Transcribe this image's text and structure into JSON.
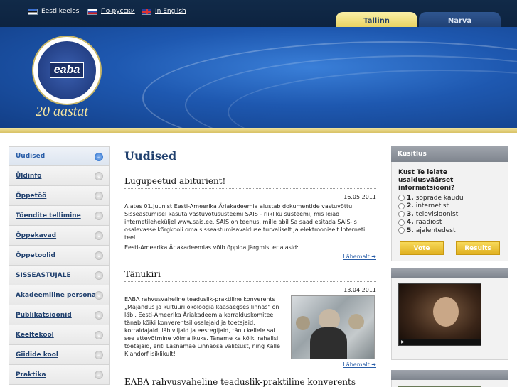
{
  "languages": [
    {
      "label": "Eesti keeles",
      "flag": "flag-ee-icon"
    },
    {
      "label": "По-русски",
      "flag": "flag-ru-icon"
    },
    {
      "label": "In English",
      "flag": "flag-gb-icon"
    }
  ],
  "city_tabs": [
    {
      "label": "Tallinn",
      "active": true
    },
    {
      "label": "Narva",
      "active": false
    }
  ],
  "banner": {
    "logo_text": "eaba",
    "anniversary": "20 aastat"
  },
  "nav": [
    {
      "label": "Uudised",
      "active": true
    },
    {
      "label": "Üldinfo"
    },
    {
      "label": "Õppetöö"
    },
    {
      "label": "Tõendite tellimine"
    },
    {
      "label": "Õppekavad"
    },
    {
      "label": "Õppetoolid"
    },
    {
      "label": "SISSEASTUJALE"
    },
    {
      "label": "Akadeemiline personal"
    },
    {
      "label": "Publikatsioonid"
    },
    {
      "label": "Keeltekool"
    },
    {
      "label": "Giidide kool"
    },
    {
      "label": "Praktika"
    }
  ],
  "main": {
    "title": "Uudised",
    "articles": [
      {
        "title": "Lugupeetud abiturient!",
        "date": "16.05.2011",
        "body": "Alates 01.juunist Eesti-Ameerika Äriakadeemia alustab dokumentide vastuvõttu. Sisseastumisel kasuta vastuvõtusüsteemi SAIS - riikliku süsteemi, mis leiad internetileheküljel www.sais.ee. SAIS on teenus, mille abil Sa saad esitada SAIS-is osalevasse kõrgkooli oma sisseastumisavalduse turvaliselt ja elektrooniselt Interneti teel.",
        "body2": "Eesti-Ameerika Äriakadeemias võib õppida järgmisi erialasid:",
        "more": "Lähemalt ➔"
      },
      {
        "title": "Tänukiri",
        "date": "13.04.2011",
        "body": "EABA rahvusvaheline teaduslik-praktiline konverents „Majandus ja kultuuri ökoloogia kaasaegses linnas\" on läbi. Eesti-Ameerika Äriakadeemia korralduskomitee tänab kõiki konverentsil osalejaid ja toetajaid, korraldajaid, läbiviijaid ja eestegijaid, tänu kellele sai see ettevõtmine võimalikuks. Täname ka kõiki rahalisi toetajaid, eriti Lasnamäe Linnaosa valitsust, ning Kalle Klandorf isiklikult!",
        "more": "Lähemalt ➔"
      },
      {
        "title": "EABA rahvusvaheline teaduslik-praktiline konverents"
      }
    ]
  },
  "poll": {
    "heading": "Küsitlus",
    "question": "Kust Te leiate usaldusväärset informatsiooni?",
    "options": [
      {
        "num": "1.",
        "label": "sõprade kaudu"
      },
      {
        "num": "2.",
        "label": "internetist"
      },
      {
        "num": "3.",
        "label": "televisioonist"
      },
      {
        "num": "4.",
        "label": "raadiost"
      },
      {
        "num": "5.",
        "label": "ajalehtedest"
      }
    ],
    "vote_label": "Vote",
    "results_label": "Results"
  },
  "colors": {
    "accent_blue": "#20406e",
    "gold": "#e0b020",
    "banner_blue": "#1e58b0"
  }
}
